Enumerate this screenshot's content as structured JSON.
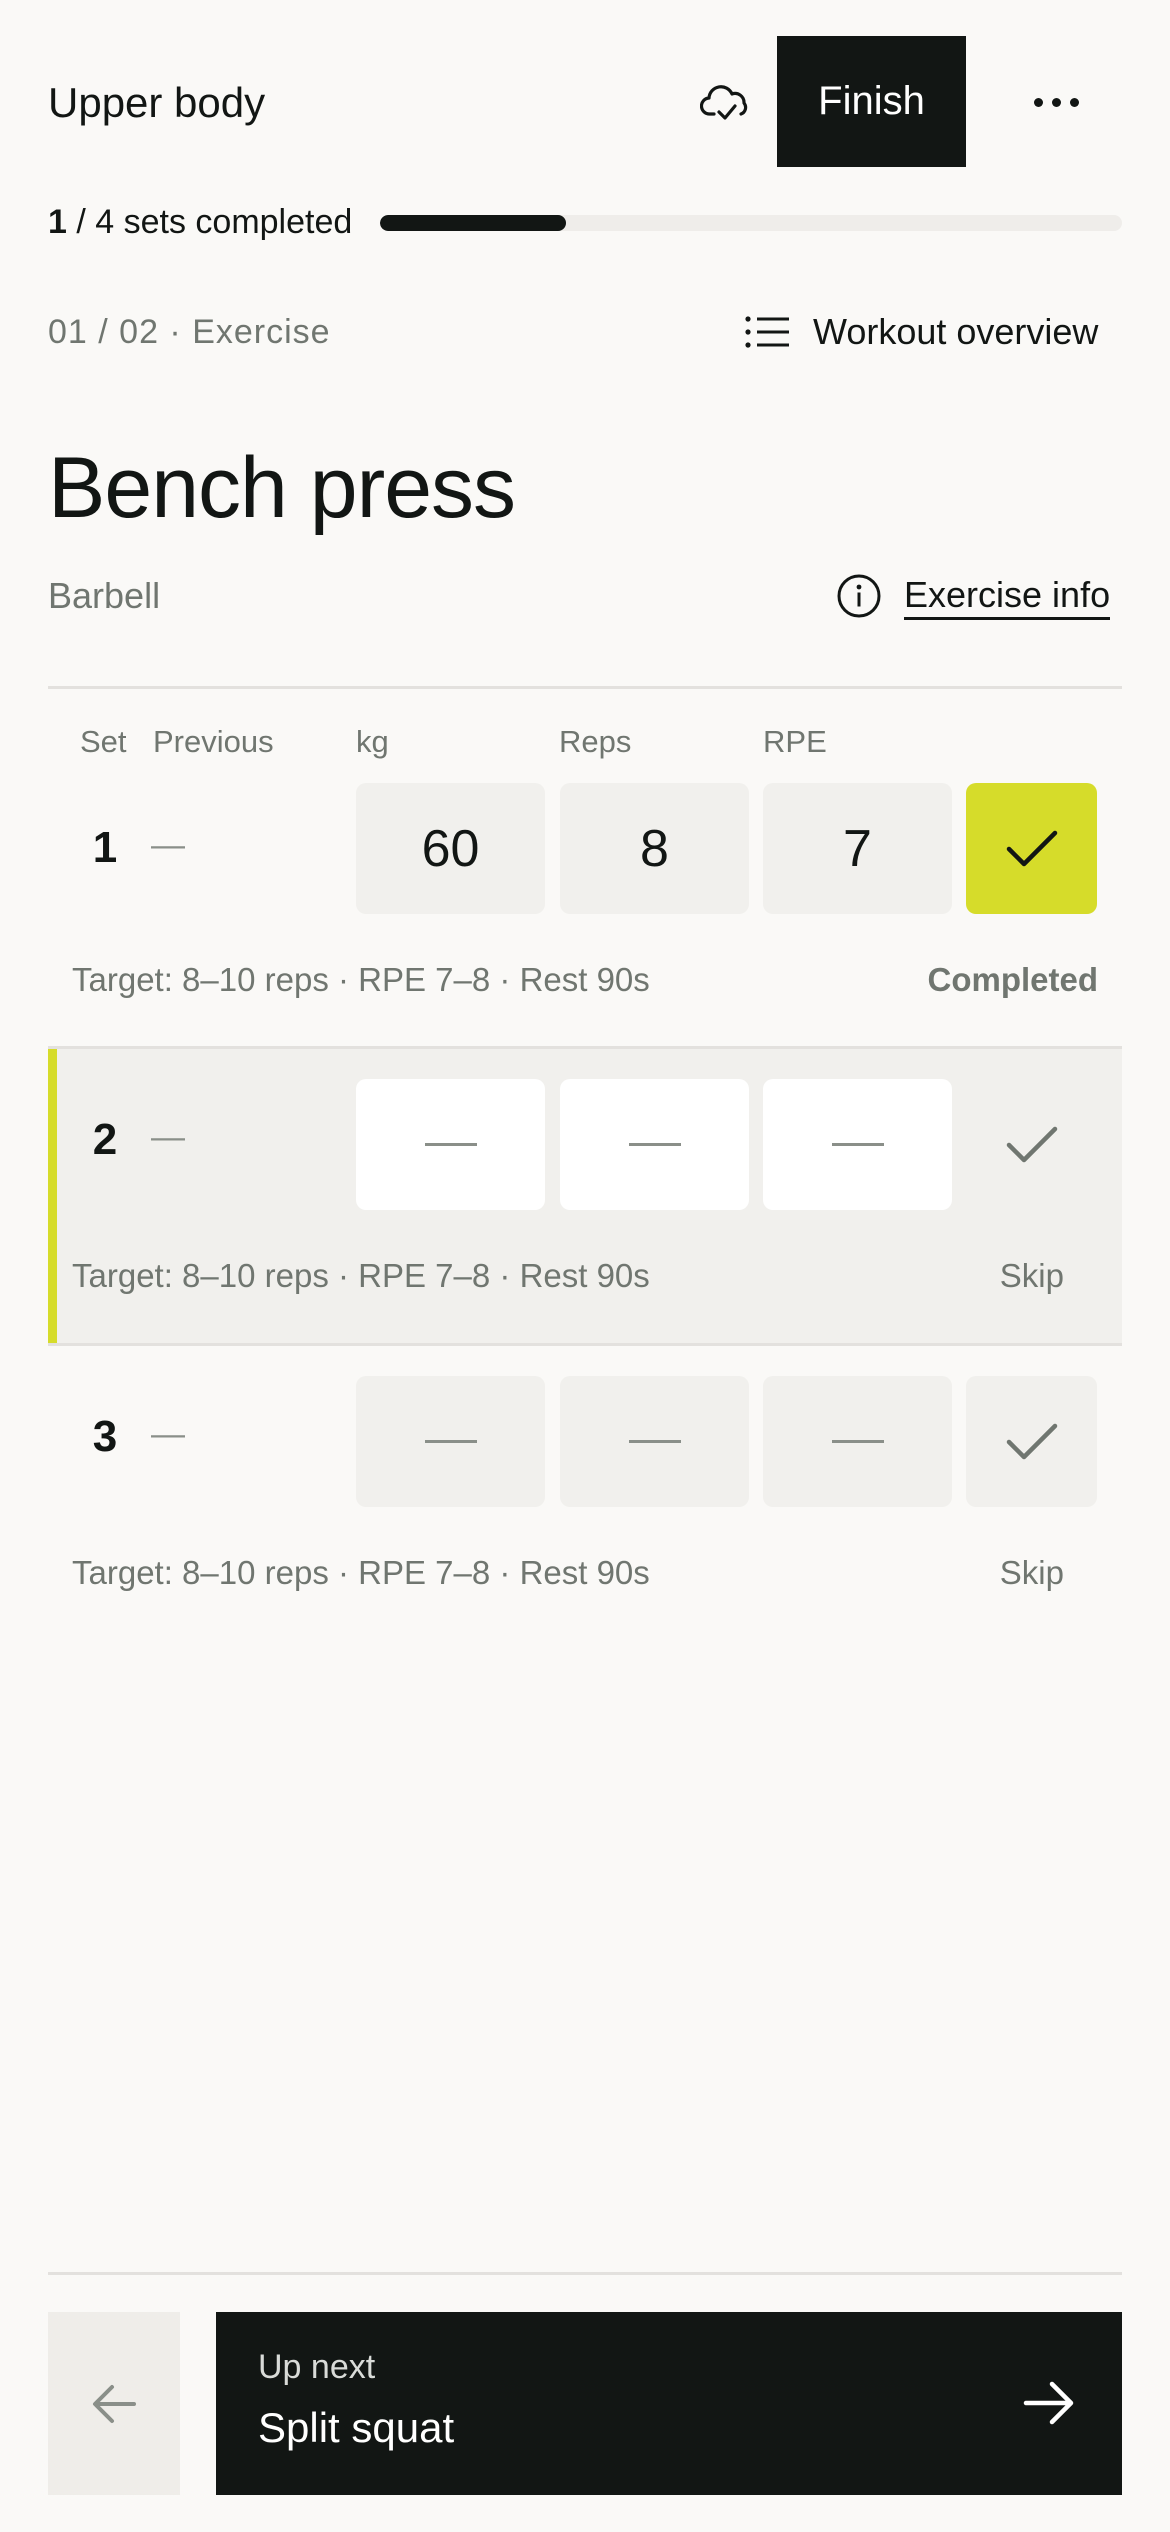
{
  "header": {
    "workout_title": "Upper body",
    "finish_label": "Finish"
  },
  "progress": {
    "completed": "1",
    "rest": " / 4 sets completed",
    "fraction": 0.25
  },
  "exercise": {
    "counter": "01 / 02 · Exercise",
    "overview_label": "Workout overview",
    "name": "Bench press",
    "equipment": "Barbell",
    "info_label": "Exercise info"
  },
  "table_headers": {
    "set": "Set",
    "previous": "Previous",
    "kg": "kg",
    "reps": "Reps",
    "rpe": "RPE"
  },
  "sets": [
    {
      "number": "1",
      "previous": "—",
      "kg": "60",
      "reps": "8",
      "rpe": "7",
      "target": "Target: 8–10 reps · RPE 7–8 · Rest 90s",
      "status": "Completed"
    },
    {
      "number": "2",
      "previous": "—",
      "kg": "",
      "reps": "",
      "rpe": "",
      "target": "Target: 8–10 reps · RPE 7–8 · Rest 90s",
      "status": "Skip"
    },
    {
      "number": "3",
      "previous": "—",
      "kg": "",
      "reps": "",
      "rpe": "",
      "target": "Target: 8–10 reps · RPE 7–8 · Rest 90s",
      "status": "Skip"
    }
  ],
  "next": {
    "kicker": "Up next",
    "name": "Split squat"
  },
  "icons": [
    "cloud-check-icon",
    "more-icon",
    "list-icon",
    "info-icon",
    "checkmark-icon",
    "arrow-left-icon",
    "arrow-right-icon"
  ],
  "colors": {
    "accent": "#d6dc2a",
    "dark": "#121614",
    "background": "#faf9f7",
    "muted_text": "#707670",
    "cell_bg": "#f1f0ed"
  }
}
